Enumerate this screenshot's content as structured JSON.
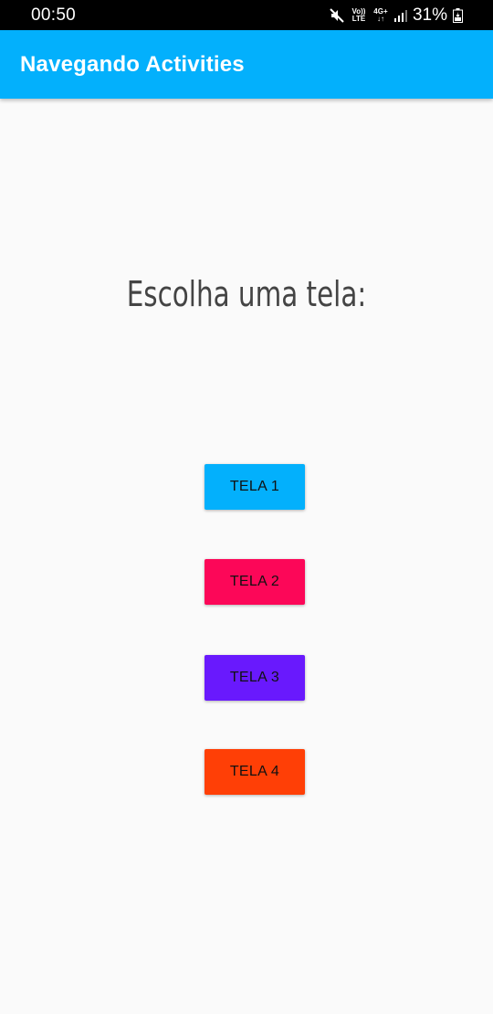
{
  "status_bar": {
    "time": "00:50",
    "volte_label_top": "Vo))",
    "volte_label_bottom": "LTE",
    "network_label_top": "4G+",
    "network_label_bottom": "↓↑",
    "battery": "31%",
    "icons": [
      "mute-icon",
      "signal-icon",
      "battery-icon"
    ]
  },
  "app_bar": {
    "title": "Navegando Activities",
    "color": "#03b0fc"
  },
  "main": {
    "prompt": "Escolha uma tela:",
    "buttons": [
      {
        "label": "TELA 1",
        "color": "#03b0fc"
      },
      {
        "label": "TELA 2",
        "color": "#fc0758"
      },
      {
        "label": "TELA 3",
        "color": "#6919fd"
      },
      {
        "label": "TELA 4",
        "color": "#ff3f06"
      }
    ]
  }
}
